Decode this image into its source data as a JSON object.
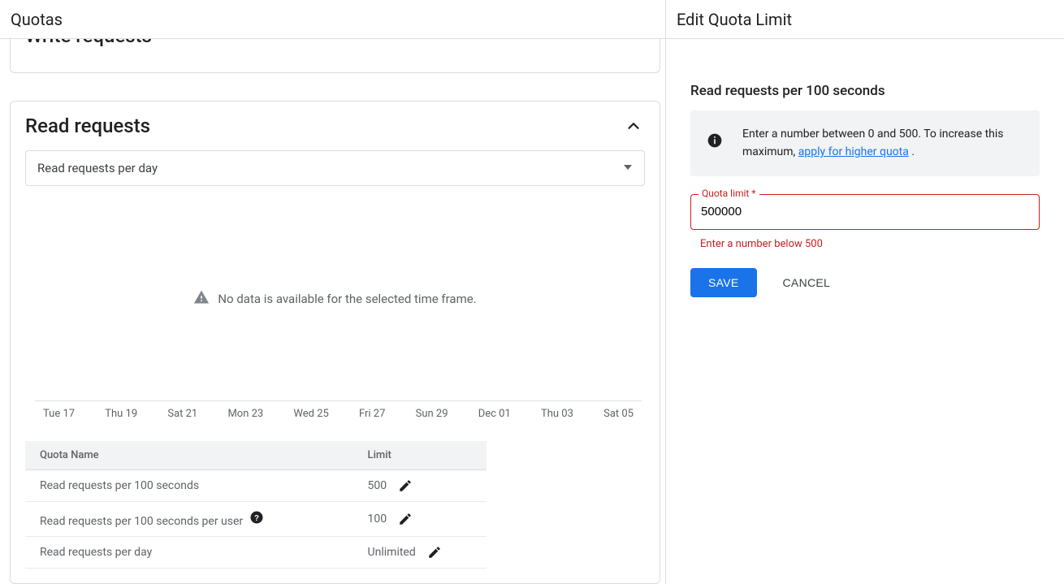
{
  "left": {
    "title": "Quotas",
    "write_title": "Write requests",
    "read": {
      "title": "Read requests",
      "select_label": "Read requests per day",
      "no_data": "No data is available for the selected time frame.",
      "axis": [
        "Tue 17",
        "Thu 19",
        "Sat 21",
        "Mon 23",
        "Wed 25",
        "Fri 27",
        "Sun 29",
        "Dec 01",
        "Thu 03",
        "Sat 05"
      ],
      "table": {
        "col_name": "Quota Name",
        "col_limit": "Limit",
        "rows": [
          {
            "name": "Read requests per 100 seconds",
            "limit": "500",
            "help": false
          },
          {
            "name": "Read requests per 100 seconds per user",
            "limit": "100",
            "help": true
          },
          {
            "name": "Read requests per day",
            "limit": "Unlimited",
            "help": false
          }
        ]
      }
    }
  },
  "right": {
    "title": "Edit Quota Limit",
    "subtitle": "Read requests per 100 seconds",
    "info_text": "Enter a number between 0 and 500. To increase this maximum, ",
    "info_link": "apply for higher quota",
    "info_suffix": " .",
    "field_label": "Quota limit *",
    "field_value": "500000",
    "error": "Enter a number below 500",
    "save": "SAVE",
    "cancel": "CANCEL"
  }
}
